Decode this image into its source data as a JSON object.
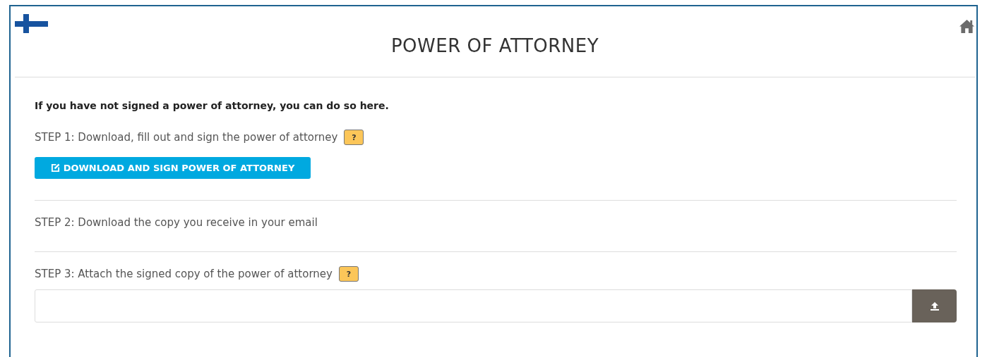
{
  "header": {
    "title": "POWER OF ATTORNEY"
  },
  "intro": "If you have not signed a power of attorney, you can do so here.",
  "steps": [
    {
      "kind": "button",
      "label": "STEP 1: Download, fill out and sign the power of attorney",
      "help": "?",
      "button": "DOWNLOAD AND SIGN POWER OF ATTORNEY"
    },
    {
      "kind": "text",
      "label": "STEP 2: Download the copy you receive in your email"
    },
    {
      "kind": "upload",
      "label": "STEP 3: Attach the signed copy of the power of attorney",
      "help": "?"
    }
  ]
}
